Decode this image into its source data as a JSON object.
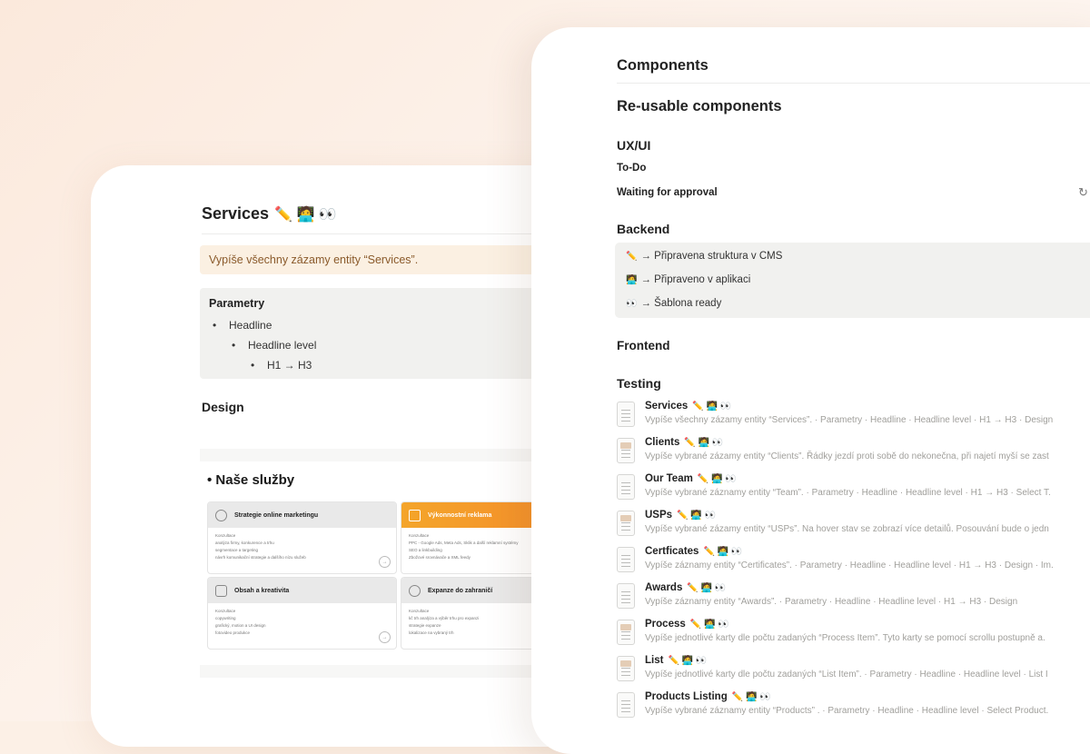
{
  "left_page": {
    "title": "Services",
    "title_emojis": "✏️ 🧑‍💻 👀",
    "callout": "Vypíše všechny zázamy entity “Services”.",
    "params_heading": "Parametry",
    "params": [
      {
        "text": "Headline",
        "level": 1
      },
      {
        "text": "Headline level",
        "level": 2
      },
      {
        "text": "H1 → H3",
        "level": 3
      }
    ],
    "design_heading": "Design",
    "preview": {
      "heading": "• Naše služby",
      "tiles": [
        {
          "title": "Strategie online marketingu",
          "label": "Konzultace",
          "lines": [
            "analýza firmy, konkurence a trhu",
            "segmentace a targeting",
            "návrh komunikační strategie a dalšího nízu služeb"
          ],
          "highlight": false
        },
        {
          "title": "Výkonnostní reklama",
          "label": "Konzultace",
          "lines": [
            "PPC - Google Ads, Meta Ads, Sklik a další reklamní systémy",
            "SEO a linkbuilding",
            "Zbožové srovnávače a XML feedy"
          ],
          "highlight": true
        },
        {
          "title": "Obsah a kreativita",
          "label": "Konzultace",
          "lines": [
            "copywriting",
            "grafický, motion a UI design",
            "fotovideo produkce"
          ],
          "highlight": false
        },
        {
          "title": "Expanze do zahraničí",
          "label": "Konzultace",
          "lines": [
            "kč trh analýza a výběr trhu pro expanzi",
            "strategie expanze",
            "lokalizace na vybraný trh"
          ],
          "highlight": false
        }
      ]
    }
  },
  "right_page": {
    "components_heading": "Components",
    "reusable_heading": "Re-usable components",
    "uxui_heading": "UX/UI",
    "todo_label": "To-Do",
    "waiting_label": "Waiting for approval",
    "backend_heading": "Backend",
    "legend": [
      {
        "emoji": "✏️",
        "text": "→ Připravena struktura v CMS"
      },
      {
        "emoji": "🧑‍💻",
        "text": "→ Připraveno v aplikaci"
      },
      {
        "emoji": "👀",
        "text": "→ Šablona ready"
      }
    ],
    "frontend_heading": "Frontend",
    "testing_heading": "Testing",
    "status_emojis": "✏️ 🧑‍💻 👀",
    "items": [
      {
        "name": "Services",
        "desc": "Vypíše všechny zázamy entity “Services”. · Parametry · Headline · Headline level · H1 → H3 · Design",
        "thumb": "doc"
      },
      {
        "name": "Clients",
        "desc": "Vypíše vybrané zázamy entity “Clients”. Řádky jezdí proti sobě do nekonečna, při najetí myší se zast",
        "thumb": "img"
      },
      {
        "name": "Our Team",
        "desc": "Vypíše vybrané záznamy entity “Team”. · Parametry · Headline · Headline level · H1 → H3 · Select T.",
        "thumb": "doc"
      },
      {
        "name": "USPs",
        "desc": "Vypíše vybrané zázamy entity “USPs”. Na hover stav se zobrazí více detailů. Posouvání bude o jedn",
        "thumb": "img"
      },
      {
        "name": "Certficates",
        "desc": "Vypíše záznamy entity “Certificates”. · Parametry · Headline · Headline level · H1 → H3 · Design · Im.",
        "thumb": "doc"
      },
      {
        "name": "Awards",
        "desc": "Vypíše záznamy entity “Awards”. · Parametry · Headline · Headline level · H1 → H3 · Design",
        "thumb": "doc"
      },
      {
        "name": "Process",
        "desc": "Vypíše jednotlivé karty dle počtu zadaných “Process Item”. Tyto karty se pomocí scrollu postupně a.",
        "thumb": "img"
      },
      {
        "name": "List",
        "desc": "Vypíše jednotlivé karty dle počtu zadaných “List Item”. · Parametry · Headline · Headline level · List I",
        "thumb": "img"
      },
      {
        "name": "Products Listing",
        "desc": "Vypíše vybrané záznamy entity “Products” . · Parametry · Headline · Headline level · Select Product.",
        "thumb": "doc"
      }
    ]
  }
}
